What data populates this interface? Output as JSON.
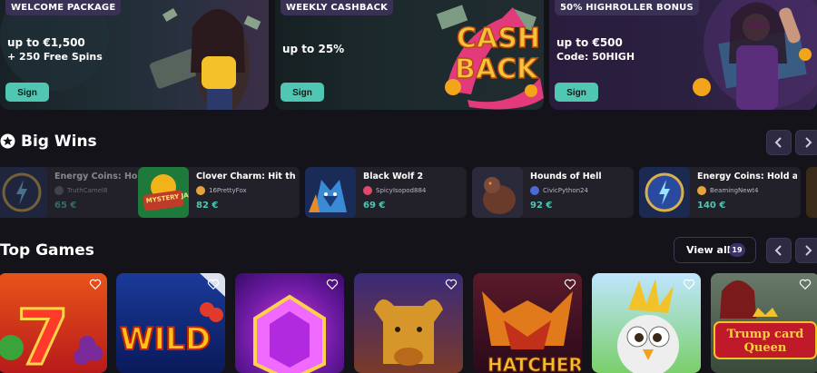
{
  "promos": [
    {
      "tag": "WELCOME PACKAGE",
      "line1": "up to €1,500",
      "line2": "+ 250 Free Spins",
      "button": "Sign up"
    },
    {
      "tag": "WEEKLY CASHBACK",
      "line1": "up to 25%",
      "line2": "",
      "button": "Sign up",
      "art_text": "CASH BACK"
    },
    {
      "tag": "50% HIGHROLLER BONUS",
      "line1": "up to €500",
      "line2": "Code: 50HIGH",
      "button": "Sign up"
    }
  ],
  "big_wins": {
    "title": "Big Wins",
    "items": [
      {
        "game": "Energy Coins: Hold and Win",
        "user": "TruthCamel8",
        "amount": "65 €",
        "thumb": "energy"
      },
      {
        "game": "Clover Charm: Hit the Bonus",
        "user": "16PrettyFox",
        "amount": "82 €",
        "thumb": "jackpot",
        "art_text": "MYSTERY JACKPOT"
      },
      {
        "game": "Black Wolf 2",
        "user": "SpicyIsopod884",
        "amount": "69 €",
        "thumb": "wolf"
      },
      {
        "game": "Hounds of Hell",
        "user": "CivicPython24",
        "amount": "92 €",
        "thumb": "hound"
      },
      {
        "game": "Energy Coins: Hold and Win",
        "user": "BeamingNewt4",
        "amount": "140 €",
        "thumb": "energy"
      }
    ]
  },
  "top_games": {
    "title": "Top Games",
    "view_all": "View all",
    "count": "19",
    "cards": [
      {
        "name": "sevens",
        "art_text": "7"
      },
      {
        "name": "wild",
        "art_text": "WILD"
      },
      {
        "name": "gem",
        "art_text": ""
      },
      {
        "name": "bull",
        "art_text": ""
      },
      {
        "name": "hatcher",
        "art_text": "HATCHER"
      },
      {
        "name": "chick",
        "art_text": ""
      },
      {
        "name": "trump-card-queen",
        "art_text": "Trump card Queen"
      }
    ]
  },
  "colors": {
    "accent": "#4fc7b3",
    "background": "#141319",
    "card": "#22212a",
    "nav": "#2d2a42"
  }
}
